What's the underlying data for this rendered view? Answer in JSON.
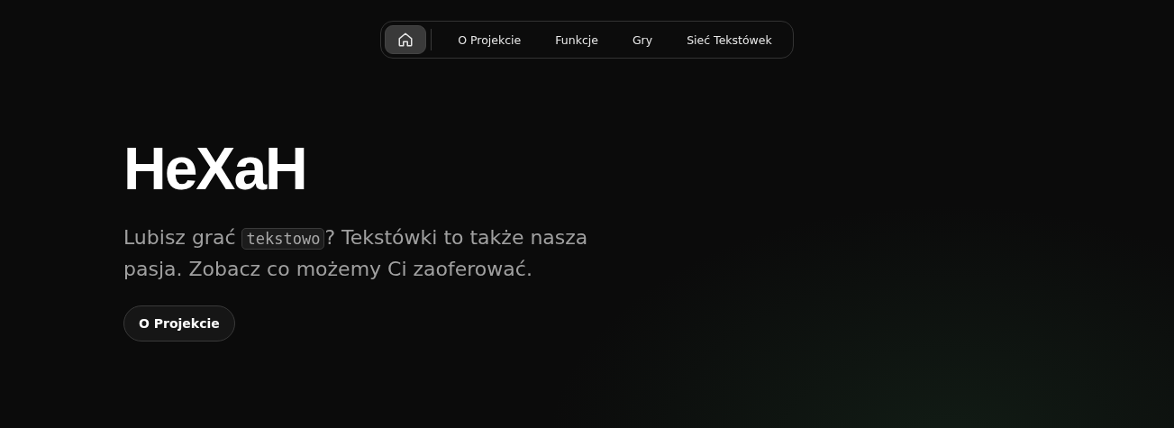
{
  "nav": {
    "home": {
      "selected": true
    },
    "items": [
      {
        "label": "O Projekcie",
        "selected": false
      },
      {
        "label": "Funkcje",
        "selected": false
      },
      {
        "label": "Gry",
        "selected": false
      },
      {
        "label": "Sieć Tekstówek",
        "selected": false
      }
    ]
  },
  "hero": {
    "title": "HeXaH",
    "tagline_before": "Lubisz grać",
    "tagline_code": "tekstowo",
    "tagline_after": "? Tekstówki to także nasza",
    "tagline_line2": "pasja. Zobacz co możemy Ci zaoferować.",
    "button": "O Projekcie"
  }
}
